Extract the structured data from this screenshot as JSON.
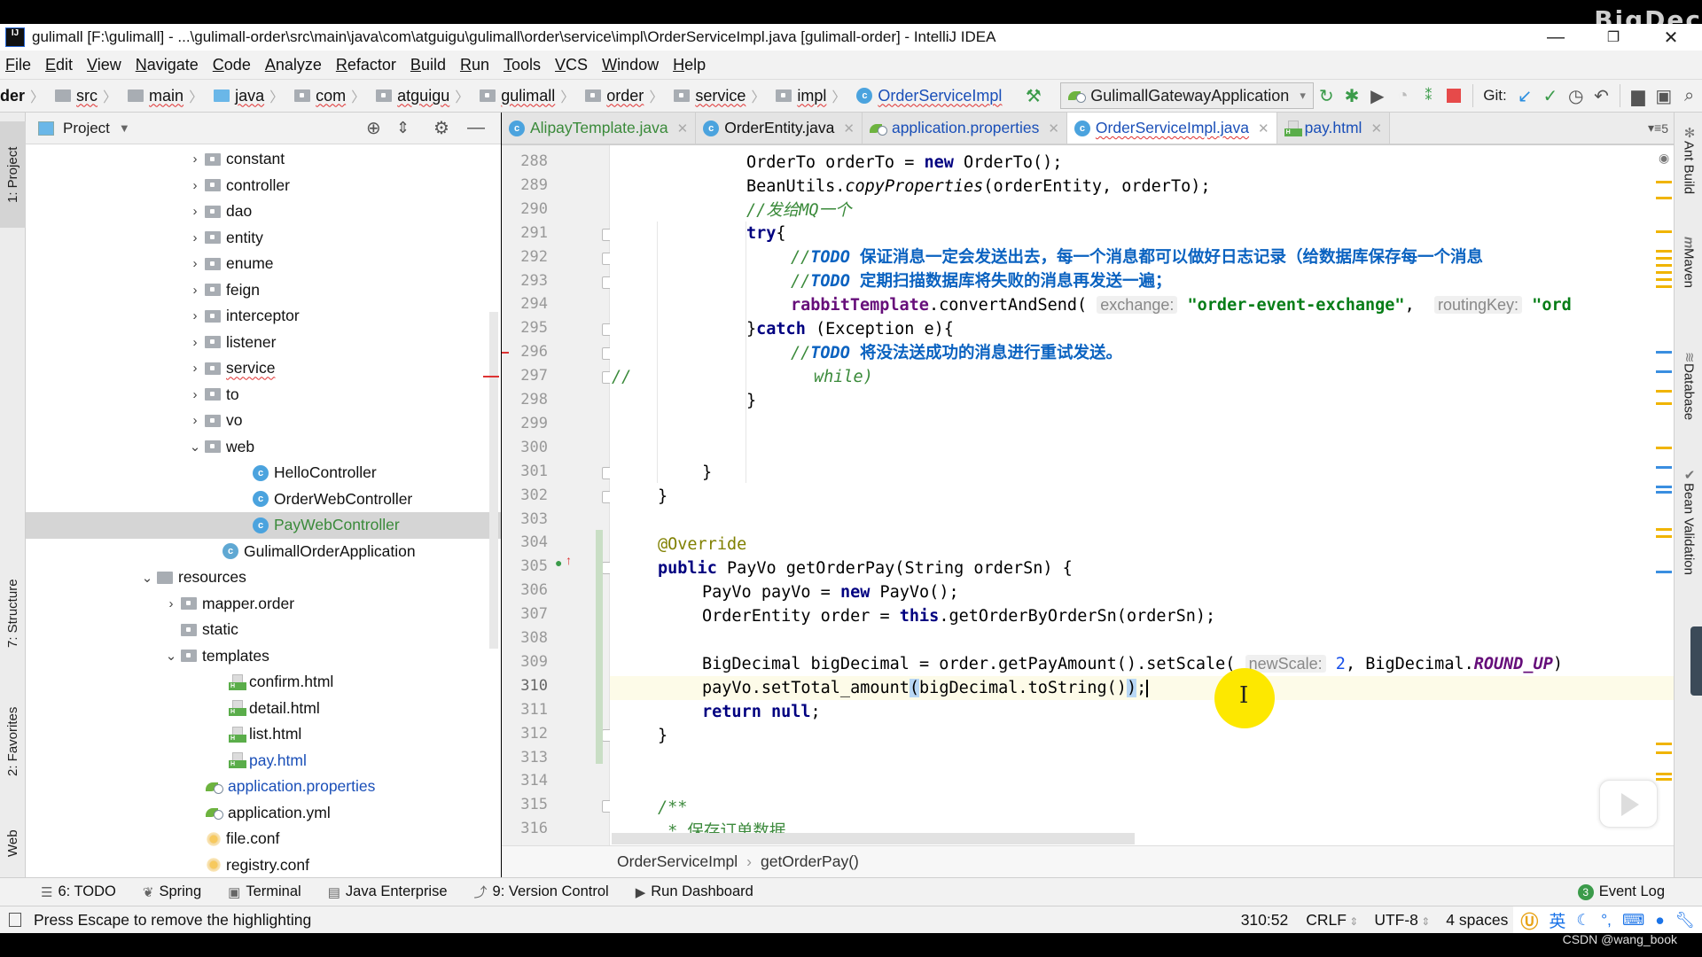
{
  "window": {
    "title": "gulimall [F:\\gulimall] - ...\\gulimall-order\\src\\main\\java\\com\\atguigu\\gulimall\\order\\service\\impl\\OrderServiceImpl.java [gulimall-order] - IntelliJ IDEA",
    "app_icon": "IJ",
    "watermark": "BigDec",
    "minimize": "—",
    "restore": "❐",
    "close": "✕"
  },
  "menu": [
    "File",
    "Edit",
    "View",
    "Navigate",
    "Code",
    "Analyze",
    "Refactor",
    "Build",
    "Run",
    "Tools",
    "VCS",
    "Window",
    "Help"
  ],
  "navbar": {
    "crumbs": [
      {
        "label": "der",
        "icon": "none"
      },
      {
        "label": "src",
        "icon": "folder"
      },
      {
        "label": "main",
        "icon": "folder"
      },
      {
        "label": "java",
        "icon": "folder-blue"
      },
      {
        "label": "com",
        "icon": "package"
      },
      {
        "label": "atguigu",
        "icon": "package"
      },
      {
        "label": "gulimall",
        "icon": "package"
      },
      {
        "label": "order",
        "icon": "package"
      },
      {
        "label": "service",
        "icon": "package"
      },
      {
        "label": "impl",
        "icon": "package"
      },
      {
        "label": "OrderServiceImpl",
        "icon": "class"
      }
    ],
    "run_config": "GulimallGatewayApplication",
    "git_label": "Git:"
  },
  "project_panel": {
    "title": "Project",
    "tree": [
      {
        "label": "constant",
        "type": "package",
        "expanded": false
      },
      {
        "label": "controller",
        "type": "package",
        "expanded": false
      },
      {
        "label": "dao",
        "type": "package",
        "expanded": false
      },
      {
        "label": "entity",
        "type": "package",
        "expanded": false
      },
      {
        "label": "enume",
        "type": "package",
        "expanded": false
      },
      {
        "label": "feign",
        "type": "package",
        "expanded": false
      },
      {
        "label": "interceptor",
        "type": "package",
        "expanded": false
      },
      {
        "label": "listener",
        "type": "package",
        "expanded": false
      },
      {
        "label": "service",
        "type": "package",
        "expanded": false
      },
      {
        "label": "to",
        "type": "package",
        "expanded": false
      },
      {
        "label": "vo",
        "type": "package",
        "expanded": false
      },
      {
        "label": "web",
        "type": "package",
        "expanded": true
      },
      {
        "label": "HelloController",
        "type": "class"
      },
      {
        "label": "OrderWebController",
        "type": "class"
      },
      {
        "label": "PayWebController",
        "type": "class",
        "selected": true
      },
      {
        "label": "GulimallOrderApplication",
        "type": "spring-app"
      },
      {
        "label": "resources",
        "type": "resources",
        "expanded": true
      },
      {
        "label": "mapper.order",
        "type": "package",
        "expanded": false
      },
      {
        "label": "static",
        "type": "package"
      },
      {
        "label": "templates",
        "type": "package",
        "expanded": true
      },
      {
        "label": "confirm.html",
        "type": "html"
      },
      {
        "label": "detail.html",
        "type": "html"
      },
      {
        "label": "list.html",
        "type": "html"
      },
      {
        "label": "pay.html",
        "type": "html",
        "modified": true
      },
      {
        "label": "application.properties",
        "type": "spring-config",
        "modified": true
      },
      {
        "label": "application.yml",
        "type": "spring-config"
      },
      {
        "label": "file.conf",
        "type": "config"
      },
      {
        "label": "registry.conf",
        "type": "config"
      }
    ]
  },
  "left_tool_tabs": [
    "1: Project",
    "7: Structure",
    "2: Favorites",
    "Web"
  ],
  "right_tool_tabs": [
    "Ant Build",
    "Maven",
    "Database",
    "Bean Validation"
  ],
  "editor": {
    "tabs": [
      {
        "label": "AlipayTemplate.java",
        "icon": "class"
      },
      {
        "label": "OrderEntity.java",
        "icon": "class"
      },
      {
        "label": "application.properties",
        "icon": "spring-config"
      },
      {
        "label": "OrderServiceImpl.java",
        "icon": "class",
        "active": true
      },
      {
        "label": "pay.html",
        "icon": "html"
      }
    ],
    "tab_overflow": "5",
    "line_numbers": [
      "288",
      "289",
      "290",
      "291",
      "292",
      "293",
      "294",
      "295",
      "296",
      "297",
      "298",
      "299",
      "300",
      "301",
      "302",
      "303",
      "304",
      "305",
      "306",
      "307",
      "308",
      "309",
      "310",
      "311",
      "312",
      "313",
      "314",
      "315",
      "316"
    ],
    "lines": {
      "l288": [
        "OrderTo orderTo = ",
        "new",
        " OrderTo();"
      ],
      "l289": [
        "BeanUtils.",
        "copyProperties",
        "(orderEntity, orderTo);"
      ],
      "l290": "//发给MQ一个",
      "l291": [
        "try",
        "{"
      ],
      "l292": [
        "//",
        "TODO",
        " 保证消息一定会发送出去，每一个消息都可以做好日志记录（给数据库保存每一个消息"
      ],
      "l293": [
        "//",
        "TODO",
        " 定期扫描数据库将失败的消息再发送一遍；"
      ],
      "l294": [
        "rabbitTemplate",
        ".convertAndSend( ",
        "exchange:",
        " \"order-event-exchange\"",
        ",  ",
        "routingKey:",
        " \"ord"
      ],
      "l295": [
        "}",
        "catch",
        " (Exception e){"
      ],
      "l296": [
        "//",
        "TODO",
        " 将没法送成功的消息进行重试发送。"
      ],
      "l297a": "//",
      "l297b": "while)",
      "l298": "}",
      "l301": "}",
      "l302": "}",
      "l304": "@Override",
      "l305": [
        "public",
        " PayVo getOrderPay(String orderSn) {"
      ],
      "l306": [
        "PayVo payVo = ",
        "new",
        " PayVo();"
      ],
      "l307": [
        "OrderEntity order = ",
        "this",
        ".getOrderByOrderSn(orderSn);"
      ],
      "l309": [
        "BigDecimal bigDecimal = order.getPayAmount().setScale( ",
        "newScale:",
        " ",
        "2",
        ", BigDecimal.",
        "ROUND_UP",
        ")"
      ],
      "l310": [
        "payVo.setTotal_amount",
        "(",
        "bigDecimal.toString()",
        ")",
        ";"
      ],
      "l311": [
        "return",
        " ",
        "null",
        ";"
      ],
      "l312": "}",
      "l315": "/**",
      "l316": " * 保存订单数据"
    },
    "breadcrumb": [
      "OrderServiceImpl",
      "getOrderPay()"
    ]
  },
  "bottom_tools": [
    {
      "label": "6: TODO",
      "icon": "list-icon"
    },
    {
      "label": "Spring",
      "icon": "spring-icon"
    },
    {
      "label": "Terminal",
      "icon": "terminal-icon"
    },
    {
      "label": "Java Enterprise",
      "icon": "java-enterprise-icon"
    },
    {
      "label": "9: Version Control",
      "icon": "vcs-icon"
    },
    {
      "label": "Run Dashboard",
      "icon": "run-icon"
    }
  ],
  "event_log": {
    "label": "Event Log",
    "count": "3"
  },
  "status": {
    "message": "Press Escape to remove the highlighting",
    "position": "310:52",
    "line_sep": "CRLF",
    "encoding": "UTF-8",
    "indent": "4 spaces",
    "ime_lang": "英"
  },
  "overlay": {
    "credit": "CSDN @wang_book"
  },
  "colors": {
    "accent": "#4ba3de",
    "keyword": "#000080",
    "string": "#067d17",
    "comment": "#3a8a3a",
    "todo": "#0a62c0",
    "field": "#660e7a"
  }
}
